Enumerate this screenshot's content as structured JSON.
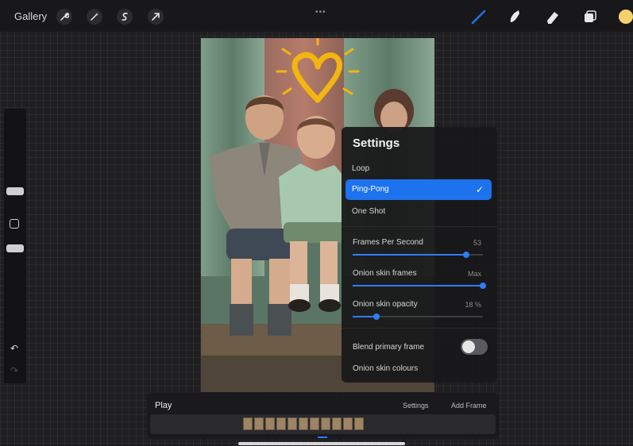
{
  "topbar": {
    "gallery_label": "Gallery",
    "left_tools": [
      {
        "icon": "wrench-icon",
        "glyph": "🔧"
      },
      {
        "icon": "magic-wand-icon",
        "glyph": "✦"
      },
      {
        "icon": "selection-icon",
        "glyph": "S"
      },
      {
        "icon": "transform-arrow-icon",
        "glyph": "➚"
      }
    ],
    "menu_dots": "•••",
    "right_tools": [
      "brush-icon",
      "smudge-icon",
      "eraser-icon",
      "layers-icon"
    ],
    "accent_color": "#1d72ee",
    "current_color": "#f6d16b"
  },
  "sidebar": {
    "undo_glyph": "↶",
    "redo_glyph": "↷"
  },
  "settings": {
    "title": "Settings",
    "options": [
      {
        "label": "Loop",
        "selected": false
      },
      {
        "label": "Ping-Pong",
        "selected": true
      },
      {
        "label": "One Shot",
        "selected": false
      }
    ],
    "check_glyph": "✓",
    "sliders": [
      {
        "label": "Frames Per Second",
        "value": "53",
        "fraction": 0.87
      },
      {
        "label": "Onion skin frames",
        "value": "Max",
        "fraction": 1.0
      },
      {
        "label": "Onion skin opacity",
        "value": "18 %",
        "fraction": 0.18
      }
    ],
    "blend_label": "Blend primary frame",
    "blend_on": false,
    "onion_colours_label": "Onion skin colours"
  },
  "timeline": {
    "play_label": "Play",
    "settings_label": "Settings",
    "add_frame_label": "Add Frame",
    "frame_count": 11,
    "current_frame": 6
  }
}
